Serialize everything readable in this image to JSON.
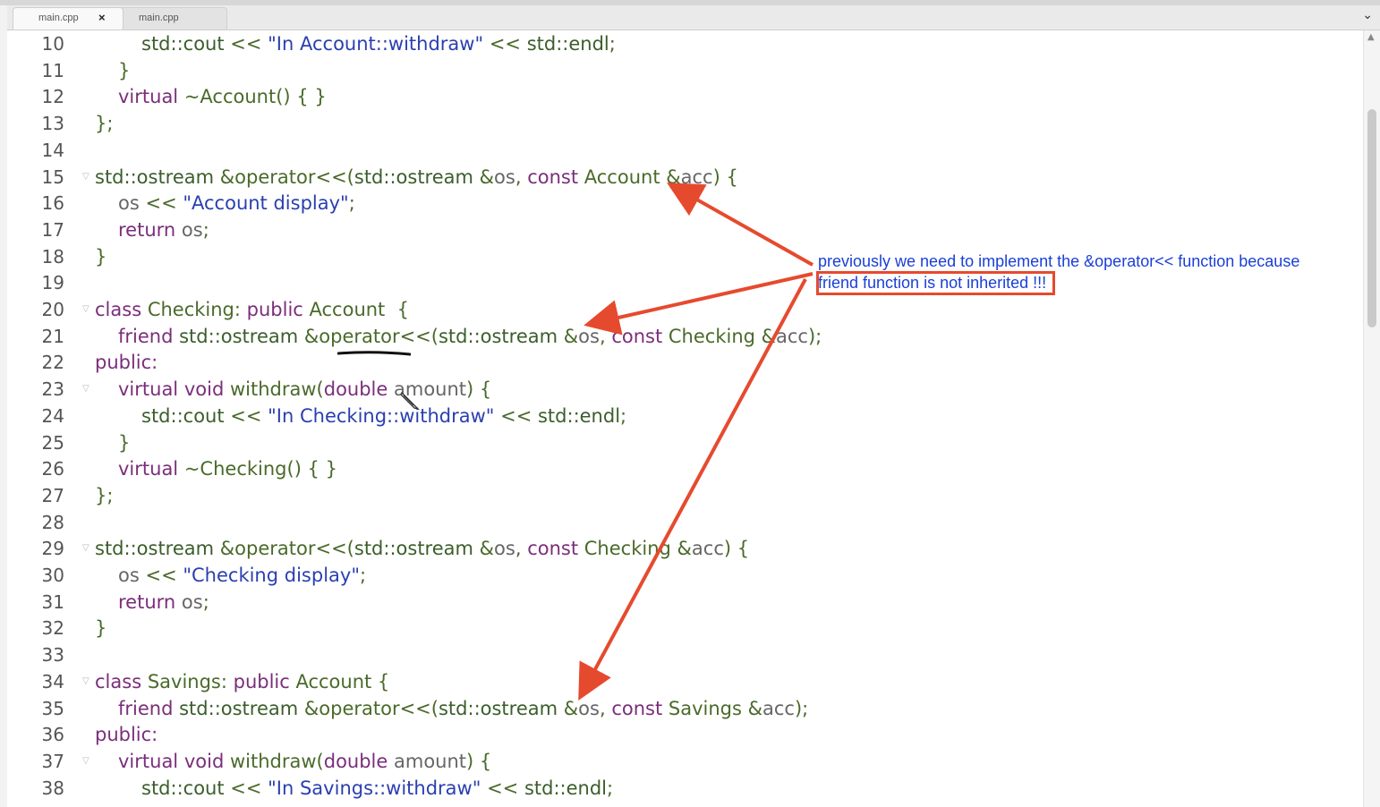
{
  "tabs": [
    {
      "label": "main.cpp",
      "close": "×"
    },
    {
      "label": "main.cpp"
    }
  ],
  "code_lines": [
    {
      "num": "10",
      "indent": 2,
      "segs": [
        [
          "ty",
          "std::cout"
        ],
        [
          "pl",
          " << "
        ],
        [
          "str",
          "\"In Account::withdraw\""
        ],
        [
          "pl",
          " << "
        ],
        [
          "ty",
          "std::endl"
        ],
        [
          "pl",
          ";"
        ]
      ]
    },
    {
      "num": "11",
      "indent": 1,
      "segs": [
        [
          "pl",
          "}"
        ]
      ]
    },
    {
      "num": "12",
      "indent": 1,
      "segs": [
        [
          "kw",
          "virtual"
        ],
        [
          "pl",
          " ~Account() { }"
        ]
      ]
    },
    {
      "num": "13",
      "indent": 0,
      "segs": [
        [
          "pl",
          "};"
        ]
      ]
    },
    {
      "num": "14",
      "indent": 0,
      "segs": []
    },
    {
      "num": "15",
      "indent": 0,
      "fold": true,
      "segs": [
        [
          "ty",
          "std::ostream"
        ],
        [
          "pl",
          " &operator<<("
        ],
        [
          "ty",
          "std::ostream"
        ],
        [
          "pl",
          " &"
        ],
        [
          "var",
          "os"
        ],
        [
          "pl",
          ", "
        ],
        [
          "kw",
          "const"
        ],
        [
          "pl",
          " Account &"
        ],
        [
          "var",
          "acc"
        ],
        [
          "pl",
          ") {"
        ]
      ]
    },
    {
      "num": "16",
      "indent": 1,
      "segs": [
        [
          "var",
          "os"
        ],
        [
          "pl",
          " << "
        ],
        [
          "str",
          "\"Account display\""
        ],
        [
          "pl",
          ";"
        ]
      ]
    },
    {
      "num": "17",
      "indent": 1,
      "segs": [
        [
          "kw",
          "return"
        ],
        [
          "pl",
          " "
        ],
        [
          "var",
          "os"
        ],
        [
          "pl",
          ";"
        ]
      ]
    },
    {
      "num": "18",
      "indent": 0,
      "segs": [
        [
          "pl",
          "}"
        ]
      ]
    },
    {
      "num": "19",
      "indent": 0,
      "segs": []
    },
    {
      "num": "20",
      "indent": 0,
      "fold": true,
      "segs": [
        [
          "kw",
          "class"
        ],
        [
          "pl",
          " Checking: "
        ],
        [
          "kw",
          "public"
        ],
        [
          "pl",
          " Account  {"
        ]
      ]
    },
    {
      "num": "21",
      "indent": 1,
      "segs": [
        [
          "kw",
          "friend"
        ],
        [
          "pl",
          " "
        ],
        [
          "ty",
          "std::ostream"
        ],
        [
          "pl",
          " &operator<<("
        ],
        [
          "ty",
          "std::ostream"
        ],
        [
          "pl",
          " &"
        ],
        [
          "var",
          "os"
        ],
        [
          "pl",
          ", "
        ],
        [
          "kw",
          "const"
        ],
        [
          "pl",
          " Checking &"
        ],
        [
          "var",
          "acc"
        ],
        [
          "pl",
          ");"
        ]
      ]
    },
    {
      "num": "22",
      "indent": 0,
      "segs": [
        [
          "kw",
          "public:"
        ]
      ]
    },
    {
      "num": "23",
      "indent": 1,
      "fold": true,
      "segs": [
        [
          "kw",
          "virtual"
        ],
        [
          "pl",
          " "
        ],
        [
          "kw",
          "void"
        ],
        [
          "pl",
          " withdraw("
        ],
        [
          "kw",
          "double"
        ],
        [
          "pl",
          " "
        ],
        [
          "var",
          "amount"
        ],
        [
          "pl",
          ") {"
        ]
      ]
    },
    {
      "num": "24",
      "indent": 2,
      "segs": [
        [
          "ty",
          "std::cout"
        ],
        [
          "pl",
          " << "
        ],
        [
          "str",
          "\"In Checking::withdraw\""
        ],
        [
          "pl",
          " << "
        ],
        [
          "ty",
          "std::endl"
        ],
        [
          "pl",
          ";"
        ]
      ]
    },
    {
      "num": "25",
      "indent": 1,
      "segs": [
        [
          "pl",
          "}"
        ]
      ]
    },
    {
      "num": "26",
      "indent": 1,
      "segs": [
        [
          "kw",
          "virtual"
        ],
        [
          "pl",
          " ~Checking() { }"
        ]
      ]
    },
    {
      "num": "27",
      "indent": 0,
      "segs": [
        [
          "pl",
          "};"
        ]
      ]
    },
    {
      "num": "28",
      "indent": 0,
      "segs": []
    },
    {
      "num": "29",
      "indent": 0,
      "fold": true,
      "segs": [
        [
          "ty",
          "std::ostream"
        ],
        [
          "pl",
          " &operator<<("
        ],
        [
          "ty",
          "std::ostream"
        ],
        [
          "pl",
          " &"
        ],
        [
          "var",
          "os"
        ],
        [
          "pl",
          ", "
        ],
        [
          "kw",
          "const"
        ],
        [
          "pl",
          " Checking &"
        ],
        [
          "var",
          "acc"
        ],
        [
          "pl",
          ") {"
        ]
      ]
    },
    {
      "num": "30",
      "indent": 1,
      "segs": [
        [
          "var",
          "os"
        ],
        [
          "pl",
          " << "
        ],
        [
          "str",
          "\"Checking display\""
        ],
        [
          "pl",
          ";"
        ]
      ]
    },
    {
      "num": "31",
      "indent": 1,
      "segs": [
        [
          "kw",
          "return"
        ],
        [
          "pl",
          " "
        ],
        [
          "var",
          "os"
        ],
        [
          "pl",
          ";"
        ]
      ]
    },
    {
      "num": "32",
      "indent": 0,
      "segs": [
        [
          "pl",
          "}"
        ]
      ]
    },
    {
      "num": "33",
      "indent": 0,
      "segs": []
    },
    {
      "num": "34",
      "indent": 0,
      "fold": true,
      "segs": [
        [
          "kw",
          "class"
        ],
        [
          "pl",
          " Savings: "
        ],
        [
          "kw",
          "public"
        ],
        [
          "pl",
          " Account {"
        ]
      ]
    },
    {
      "num": "35",
      "indent": 1,
      "segs": [
        [
          "kw",
          "friend"
        ],
        [
          "pl",
          " "
        ],
        [
          "ty",
          "std::ostream"
        ],
        [
          "pl",
          " &operator<<("
        ],
        [
          "ty",
          "std::ostream"
        ],
        [
          "pl",
          " &"
        ],
        [
          "var",
          "os"
        ],
        [
          "pl",
          ", "
        ],
        [
          "kw",
          "const"
        ],
        [
          "pl",
          " Savings &"
        ],
        [
          "var",
          "acc"
        ],
        [
          "pl",
          ");"
        ]
      ]
    },
    {
      "num": "36",
      "indent": 0,
      "segs": [
        [
          "kw",
          "public:"
        ]
      ]
    },
    {
      "num": "37",
      "indent": 1,
      "fold": true,
      "segs": [
        [
          "kw",
          "virtual"
        ],
        [
          "pl",
          " "
        ],
        [
          "kw",
          "void"
        ],
        [
          "pl",
          " withdraw("
        ],
        [
          "kw",
          "double"
        ],
        [
          "pl",
          " "
        ],
        [
          "var",
          "amount"
        ],
        [
          "pl",
          ") {"
        ]
      ]
    },
    {
      "num": "38",
      "indent": 2,
      "segs": [
        [
          "ty",
          "std::cout"
        ],
        [
          "pl",
          " << "
        ],
        [
          "str",
          "\"In Savings::withdraw\""
        ],
        [
          "pl",
          " << "
        ],
        [
          "ty",
          "std::endl"
        ],
        [
          "pl",
          ";"
        ]
      ]
    }
  ],
  "annotation": {
    "line1": "previously we need to implement the &operator<< function because",
    "highlighted": "friend function is not inherited",
    "suffix": " !!!"
  },
  "colors": {
    "annotation_text": "#1a3fd6",
    "arrow": "#e64a2e",
    "keyword": "#7a2e7a",
    "type": "#3b5e2b",
    "string": "#2a3fb0"
  },
  "icons": {
    "tab_close": "close-icon",
    "tab_overflow": "chevron-down-icon",
    "scroll_up": "scroll-up-icon",
    "cursor": "pencil-cursor-icon"
  }
}
